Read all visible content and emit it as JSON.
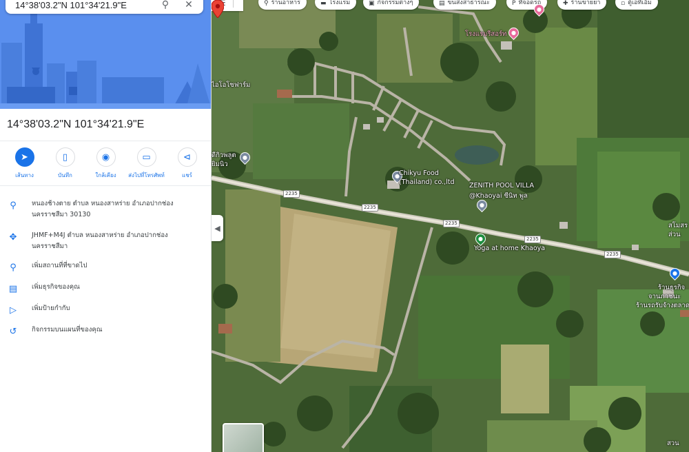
{
  "search": {
    "query": "14°38'03.2\"N 101°34'21.9\"E"
  },
  "place": {
    "title": "14°38'03.2\"N 101°34'21.9\"E"
  },
  "actions": [
    {
      "label": "เส้นทาง",
      "icon": "directions-icon"
    },
    {
      "label": "บันทึก",
      "icon": "bookmark-icon"
    },
    {
      "label": "ใกล้เคียง",
      "icon": "nearby-icon"
    },
    {
      "label": "ส่งไปที่โทรศัพท์",
      "icon": "send-to-phone-icon"
    },
    {
      "label": "แชร์",
      "icon": "share-icon"
    }
  ],
  "info": [
    {
      "line1": "หนองช้างตาย ตำบล หนองสาหร่าย อำเภอปากช่อง",
      "line2": "นครราชสีมา 30130",
      "icon": "location-pin-icon"
    },
    {
      "line1": "JHMF+M4J ตำบล หนองสาหร่าย อำเภอปากช่อง",
      "line2": "นครราชสีมา",
      "icon": "plus-code-icon"
    },
    {
      "line1": "เพิ่มสถานที่ที่ขาดไป",
      "line2": "",
      "icon": "add-place-icon"
    },
    {
      "line1": "เพิ่มธุรกิจของคุณ",
      "line2": "",
      "icon": "add-business-icon"
    },
    {
      "line1": "เพิ่มป้ายกำกับ",
      "line2": "",
      "icon": "label-icon"
    },
    {
      "line1": "กิจกรรมบนแผนที่ของคุณ",
      "line2": "",
      "icon": "history-icon"
    }
  ],
  "map": {
    "chips": [
      {
        "label": "ร้านอาหาร",
        "icon": "restaurant-icon"
      },
      {
        "label": "โรงแรม",
        "icon": "hotel-icon"
      },
      {
        "label": "กิจกรรมต่างๆ",
        "icon": "activities-icon"
      },
      {
        "label": "ขนส่งสาธารณะ",
        "icon": "transit-icon"
      },
      {
        "label": "ที่จอดรถ",
        "icon": "parking-icon"
      },
      {
        "label": "ร้านขายยา",
        "icon": "pharmacy-icon"
      },
      {
        "label": "ตู้เอทีเอ็ม",
        "icon": "atm-icon"
      }
    ],
    "labels": {
      "resort": "โรงแรมรีสอร์ท",
      "farm": "ไอโอโซฟาร์ม",
      "left_poi_1": "ดีกิวพลูต",
      "left_poi_2": "ยิมนิว",
      "food_1": "Chikyu Food",
      "food_2": "(Thailand) co.,ltd",
      "zenith_1": "ZENITH POOL VILLA",
      "zenith_2": "@Khaoyai ซีนิท พูล",
      "yoga": "Yoga at home Khaoya",
      "shop_1": "ร้านธุรกิจ",
      "shop_2": "จานภาชนะ",
      "shop_3": "ร้านรถรับจ้างตลาด",
      "right_1": "สโมสร",
      "right_2": "ส่วน",
      "bottom_right": "สวน"
    },
    "road_shields": [
      "2235",
      "2235",
      "2235",
      "2235",
      "2235"
    ]
  }
}
